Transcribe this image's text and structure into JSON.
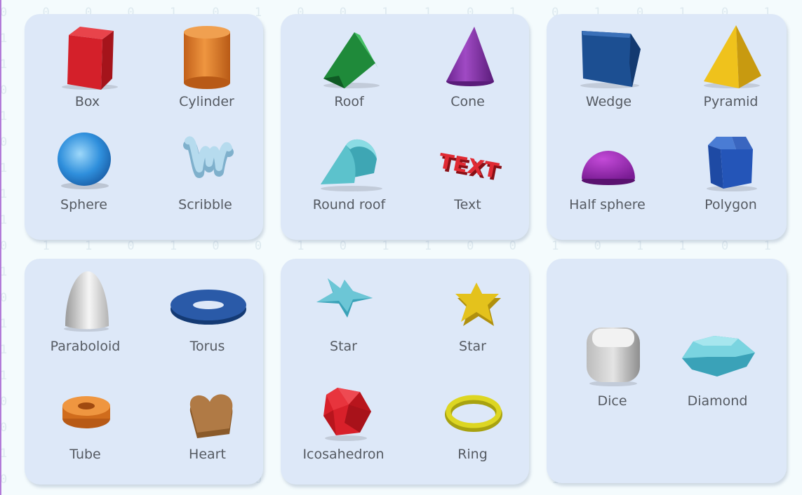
{
  "background_digits": [
    "0 0 0 0 1 0 1 0 0 1 1 0 1 0 1 0 1 0 1 1 0 0 1 0 0 1 0",
    "1 0 0 1 1 0 0 0 0 1 1 1 0 1 1 0 0 1 0 1 0 1 1 1 1 1 0",
    "1 1 0 0 1 1 0 1 0 0 1 1 1 0 0 1 0 0 0 1 0 0 1 0 1 0 1",
    "0 0 0 0 1 1 1 0 0 1 1 0 0 1 1 1 1 1 0 0 1 1 0 0 0 0 0",
    "1 0 1 1 0 0 0 1 0 0 1 0 1 0 1 0 1 0 0 0 1 0 0 1 0 1 1",
    "0 1 1 1 0 0 1 1 0 1 0 1 1 0 0 1 0 1 1 0 1 1 0 1 0 1 1",
    "1 0 0 0 0 1 1 0 0 1 0 1 0 1 1 1 0 1 1 0 0 0 1 0 0 1 0",
    "1 0 0 1 1 1 0 0 0 1 1 0 0 1 0 0 0 0 1 0 1 0 0 0 1 0 1",
    "1 1 1 0 0 1 1 0 1 0 0 1 0 1 1 1 0 1 0 0 0 0 0 1 1 0 0",
    "0 1 1 0 1 0 0 1 0 1 1 0 0 1 0 1 1 0 1 1 1 0 1 0 1 1 0",
    "1 1 1 1 0 1 1 0 0 1 1 0 0 1 1 1 0 1 1 0 1 1 0 0 1 1 1",
    "0 0 0 0 0 0 0 0 1 1 0 1 0 0 0 1 0 0 1 1 0 1 0 1 0 0 0",
    "1 1 0 1 0 1 0 1 0 0 0 1 0 1 0 0 0 1 1 0 0 1 1 1 0 0 1",
    "1 1 1 0 1 1 1 0 0 0 1 1 0 1 1 0 1 0 0 0 0 1 0 1 1 1 0",
    "1 1 0 0 1 0 1 1 0 0 0 0 0 1 0 0 0 1 1 0 0 1 1 0 1 1 1",
    "0 1 0 0 0 0 0 0 0 0 0 0 1 0 1 0 1 1 1 0 1 0 0 1 1 1 1",
    "0 1 1 0 1 0 0 0 0 1 1 0 0 1 1 0 1 0 1 1 1 0 1 0 0 0 0",
    "1 1 0 0 1 1 0 1 1 0 0 1 0 1 0 1 0 0 1 1 1 0 0 1 0 0 1",
    "0 0 1 0 1 0 0 1 0 1 0 1 1 1 0 1 1 0 0 0 0 0 1 1 0 1 1",
    "0 1 0 0 0 1 1 0 0 0 1 0 1 0 0 1 0 0 0 0 1 0 1 0 0 0 1"
  ],
  "accent_color": "#b27ad8",
  "groups": [
    {
      "items": [
        {
          "id": "box",
          "label": "Box",
          "icon": "box-icon",
          "color": "#d4202a"
        },
        {
          "id": "cylinder",
          "label": "Cylinder",
          "icon": "cylinder-icon",
          "color": "#e07c22"
        },
        {
          "id": "sphere",
          "label": "Sphere",
          "icon": "sphere-icon",
          "color": "#2f8fdc"
        },
        {
          "id": "scribble",
          "label": "Scribble",
          "icon": "scribble-icon",
          "color": "#9fcbe2"
        }
      ]
    },
    {
      "items": [
        {
          "id": "roof",
          "label": "Roof",
          "icon": "roof-icon",
          "color": "#2ea84a"
        },
        {
          "id": "cone",
          "label": "Cone",
          "icon": "cone-icon",
          "color": "#8a3aa8"
        },
        {
          "id": "round-roof",
          "label": "Round roof",
          "icon": "round-roof-icon",
          "color": "#5cc2cc"
        },
        {
          "id": "text",
          "label": "Text",
          "icon": "text-3d-icon",
          "color": "#d8202a",
          "icon_text": "TEXT"
        }
      ]
    },
    {
      "items": [
        {
          "id": "wedge",
          "label": "Wedge",
          "icon": "wedge-icon",
          "color": "#1c4f92"
        },
        {
          "id": "pyramid",
          "label": "Pyramid",
          "icon": "pyramid-icon",
          "color": "#efc21c"
        },
        {
          "id": "half-sphere",
          "label": "Half sphere",
          "icon": "half-sphere-icon",
          "color": "#9a2ab0"
        },
        {
          "id": "polygon",
          "label": "Polygon",
          "icon": "polygon-icon",
          "color": "#2455b8"
        }
      ]
    },
    {
      "items": [
        {
          "id": "paraboloid",
          "label": "Paraboloid",
          "icon": "paraboloid-icon",
          "color": "#e4e4e4"
        },
        {
          "id": "torus",
          "label": "Torus",
          "icon": "torus-icon",
          "color": "#1f4a94"
        },
        {
          "id": "tube",
          "label": "Tube",
          "icon": "tube-icon",
          "color": "#e47a1c"
        },
        {
          "id": "heart",
          "label": "Heart",
          "icon": "heart-icon",
          "color": "#b07a45"
        }
      ]
    },
    {
      "items": [
        {
          "id": "star-1",
          "label": "Star",
          "icon": "star-flat-icon",
          "color": "#6cc6d6"
        },
        {
          "id": "star-2",
          "label": "Star",
          "icon": "star-icon",
          "color": "#e4c21c"
        },
        {
          "id": "icosahedron",
          "label": "Icosahedron",
          "icon": "icosahedron-icon",
          "color": "#d8202a"
        },
        {
          "id": "ring",
          "label": "Ring",
          "icon": "ring-icon",
          "color": "#d8d21c"
        }
      ]
    },
    {
      "items": [
        {
          "id": "dice",
          "label": "Dice",
          "icon": "dice-icon",
          "color": "#cfcfcf"
        },
        {
          "id": "diamond",
          "label": "Diamond",
          "icon": "diamond-icon",
          "color": "#6ac6d4"
        }
      ]
    }
  ]
}
